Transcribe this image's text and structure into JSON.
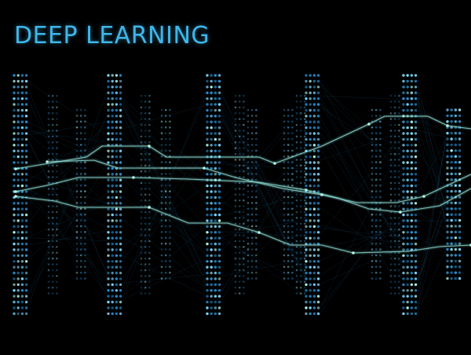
{
  "title": "DEEP LEARNING",
  "colors": {
    "background": "#000000",
    "title": "#3fb6e9",
    "dot_blue": "#2a8fd0",
    "dot_bright": "#7fd8ff",
    "dot_mint": "#b8f5e6",
    "trace": "#8fe0d8"
  }
}
